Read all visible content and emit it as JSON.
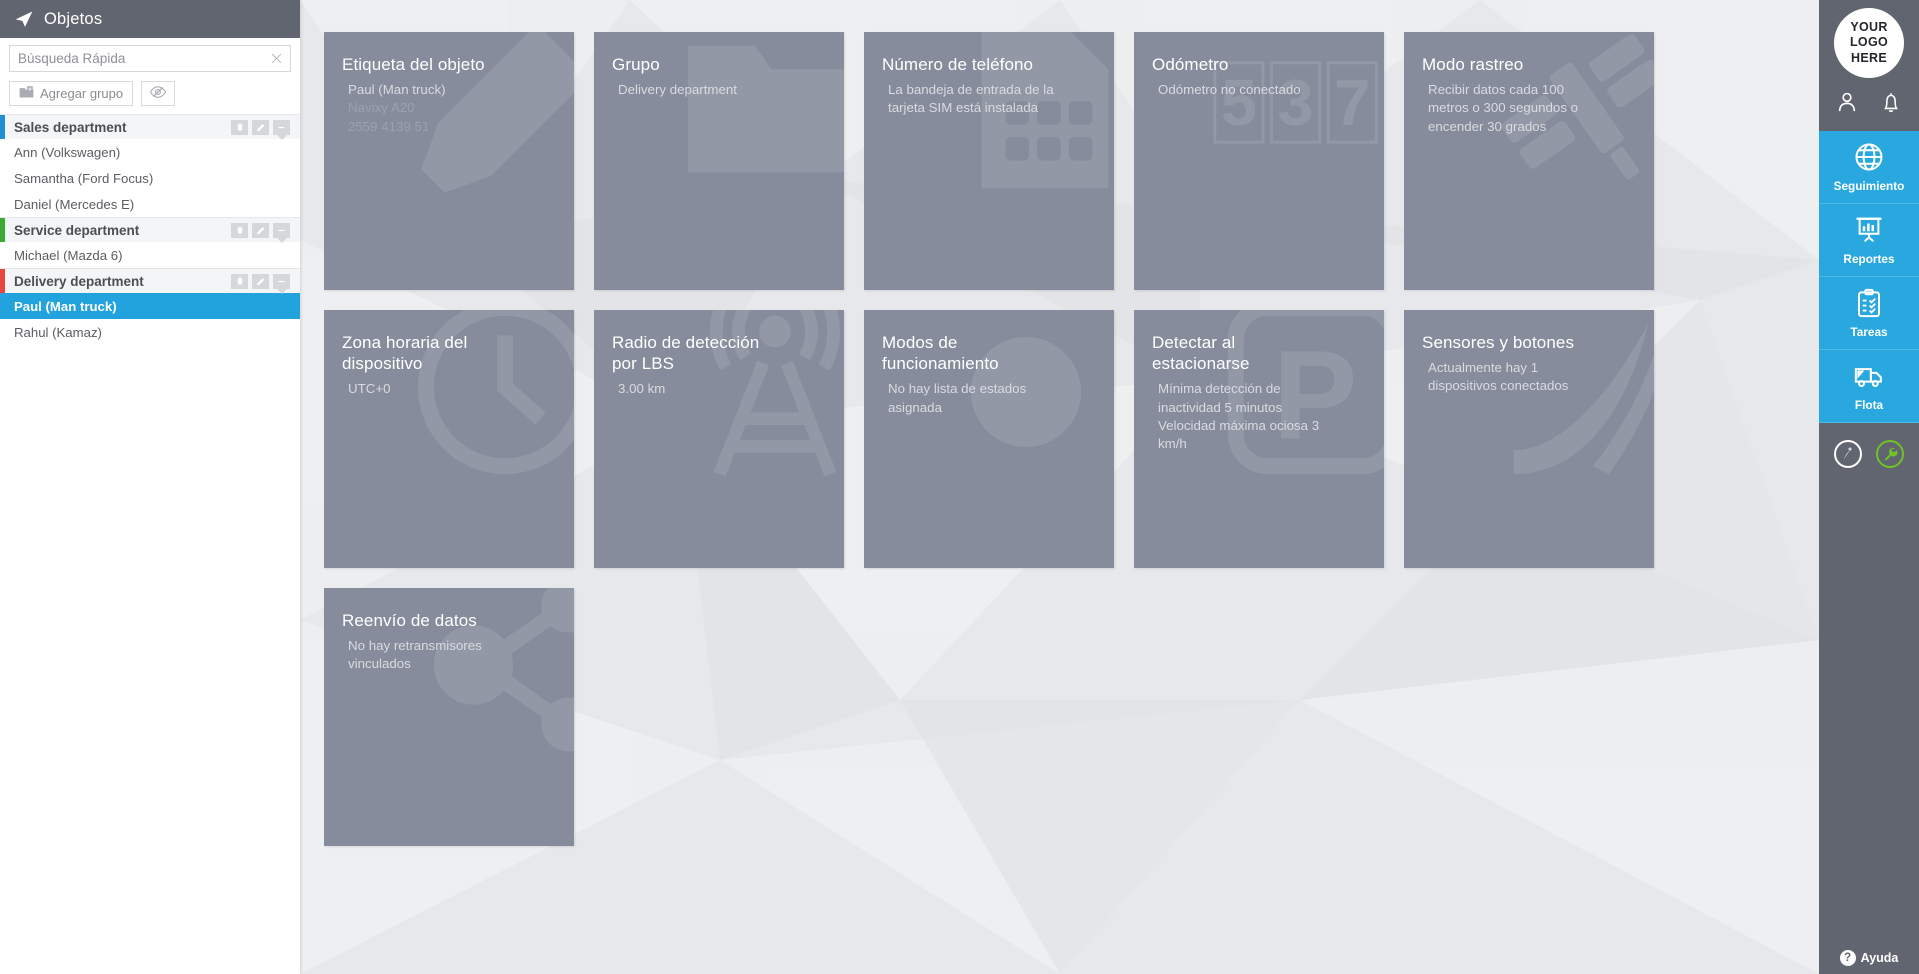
{
  "left_panel": {
    "title": "Objetos",
    "nav_icon": "navigation-arrow-icon",
    "search": {
      "placeholder": "Búsqueda Rápida",
      "value": "",
      "clear_icon": "close-icon"
    },
    "add_group_label": "Agregar grupo",
    "add_group_icon": "folder-plus-icon",
    "visibility_icon": "eye-slash-icon",
    "group_action_icons": [
      "trash-icon",
      "pencil-icon",
      "collapse-icon"
    ],
    "groups": [
      {
        "name": "Sales department",
        "color": "#1f8fd6",
        "objects": [
          {
            "label": "Ann (Volkswagen)",
            "selected": false
          },
          {
            "label": "Samantha (Ford Focus)",
            "selected": false
          },
          {
            "label": "Daniel (Mercedes E)",
            "selected": false
          }
        ]
      },
      {
        "name": "Service department",
        "color": "#3aaa35",
        "objects": [
          {
            "label": "Michael (Mazda 6)",
            "selected": false
          }
        ]
      },
      {
        "name": "Delivery department",
        "color": "#e8453c",
        "objects": [
          {
            "label": "Paul (Man truck)",
            "selected": true
          },
          {
            "label": "Rahul (Kamaz)",
            "selected": false
          }
        ]
      }
    ]
  },
  "cards": [
    {
      "title": "Etiqueta del objeto",
      "lines": [
        "Paul (Man truck)"
      ],
      "dim_lines": [
        "Navixy A20",
        "2559 4139 51"
      ],
      "watermark": "pencil-icon"
    },
    {
      "title": "Grupo",
      "lines": [
        "Delivery department"
      ],
      "dim_lines": [],
      "watermark": "folder-icon"
    },
    {
      "title": "Número de teléfono",
      "lines": [
        "La bandeja de entrada de la tarjeta SIM está instalada"
      ],
      "dim_lines": [],
      "watermark": "sim-card-icon"
    },
    {
      "title": "Odómetro",
      "lines": [
        "Odómetro no conectado"
      ],
      "dim_lines": [],
      "watermark": "odometer-digits-icon"
    },
    {
      "title": "Modo rastreo",
      "lines": [
        "Recibir datos cada 100 metros o 300 segundos o encender 30 grados"
      ],
      "dim_lines": [],
      "watermark": "satellite-icon"
    },
    {
      "title": "Zona horaria del dispositivo",
      "lines": [
        "UTC+0"
      ],
      "dim_lines": [],
      "watermark": "clock-icon"
    },
    {
      "title": "Radio de detección por LBS",
      "lines": [
        "3.00 km"
      ],
      "dim_lines": [],
      "watermark": "antenna-tower-icon"
    },
    {
      "title": "Modos de funcionamiento",
      "lines": [
        "No hay lista de estados asignada"
      ],
      "dim_lines": [],
      "watermark": "circle-icon"
    },
    {
      "title": "Detectar al estacionarse",
      "lines": [
        "Mínima detección de inactividad 5 minutos",
        "Velocidad máxima ociosa 3 km/h"
      ],
      "dim_lines": [],
      "watermark": "parking-p-icon"
    },
    {
      "title": "Sensores y botones",
      "lines": [
        "Actualmente hay 1 dispositivos conectados"
      ],
      "dim_lines": [],
      "watermark": "sensor-icon"
    },
    {
      "title": "Reenvío de datos",
      "lines": [
        "No hay retransmisores vinculados"
      ],
      "dim_lines": [],
      "watermark": "network-nodes-icon"
    }
  ],
  "rail": {
    "logo": {
      "line1": "YOUR",
      "line2": "LOGO",
      "line3": "HERE"
    },
    "top_icons": [
      "user-icon",
      "bell-icon"
    ],
    "nav_items": [
      {
        "label": "Seguimiento",
        "icon": "globe-icon"
      },
      {
        "label": "Reportes",
        "icon": "report-chart-icon"
      },
      {
        "label": "Tareas",
        "icon": "clipboard-checklist-icon"
      },
      {
        "label": "Flota",
        "icon": "truck-icon"
      }
    ],
    "bottom_icons": [
      "cursor-add-icon",
      "wrench-icon"
    ],
    "accent_color": "#29a8e0",
    "wrench_color": "#6fc12a"
  },
  "help": {
    "label": "Ayuda",
    "icon": "question-mark-icon"
  }
}
